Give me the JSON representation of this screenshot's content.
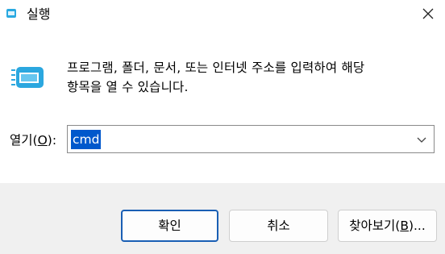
{
  "window": {
    "title": "실행"
  },
  "message": {
    "line1": "프로그램, 폴더, 문서, 또는 인터넷 주소를 입력하여 해당",
    "line2": "항목을 열 수 있습니다."
  },
  "open_field": {
    "label": "열기(",
    "label_accel": "O",
    "label_tail": "):",
    "value": "cmd"
  },
  "buttons": {
    "ok": "확인",
    "cancel": "취소",
    "browse_prefix": "찾아보기(",
    "browse_accel": "B",
    "browse_tail": ")..."
  },
  "colors": {
    "selection": "#0058cc",
    "footer_bg": "#f0f0f0",
    "default_button_border": "#1a5fb4"
  }
}
